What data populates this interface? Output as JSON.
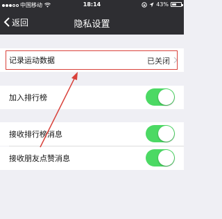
{
  "status_bar": {
    "carrier": "中国移动",
    "time": "18:14",
    "battery": "43%"
  },
  "nav": {
    "back_label": "返回",
    "title": "隐私设置"
  },
  "settings": {
    "record_sport": {
      "label": "记录运动数据",
      "value": "已关闭"
    },
    "join_ranking": {
      "label": "加入排行榜",
      "toggle_on": true
    },
    "receive_ranking_msg": {
      "label": "接收排行榜消息",
      "toggle_on": true
    },
    "receive_like_msg": {
      "label": "接收朋友点赞消息",
      "toggle_on": true
    }
  },
  "colors": {
    "nav_bg": "#2e2e32",
    "toggle_on": "#4cd964",
    "annotation": "#d9413a"
  }
}
